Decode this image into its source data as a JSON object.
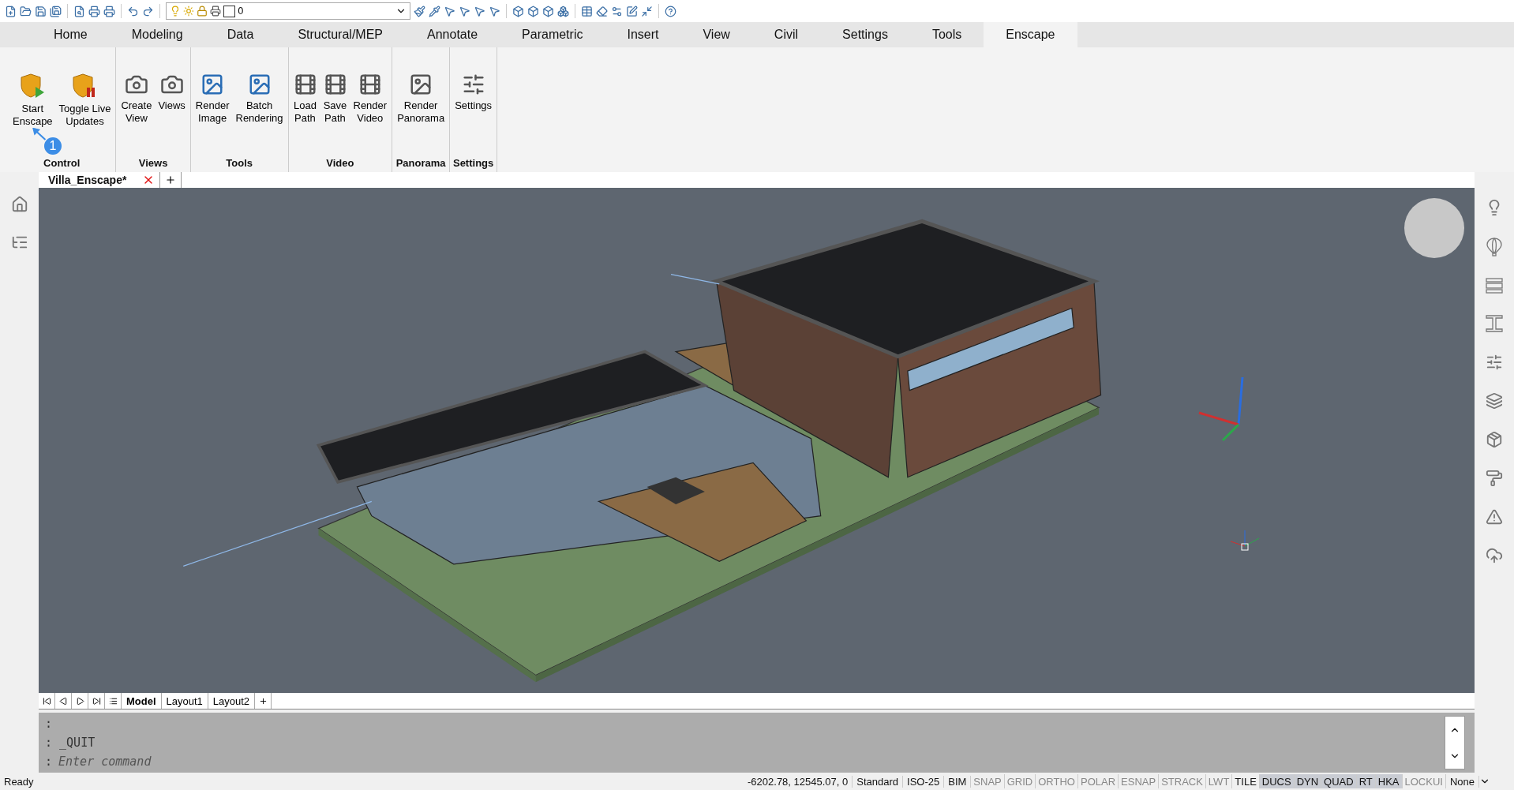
{
  "quick_toolbar": {
    "layer": "0"
  },
  "ribbon_tabs": [
    {
      "label": "Home",
      "selected": false
    },
    {
      "label": "Modeling",
      "selected": false
    },
    {
      "label": "Data",
      "selected": false
    },
    {
      "label": "Structural/MEP",
      "selected": false
    },
    {
      "label": "Annotate",
      "selected": false
    },
    {
      "label": "Parametric",
      "selected": false
    },
    {
      "label": "Insert",
      "selected": false
    },
    {
      "label": "View",
      "selected": false
    },
    {
      "label": "Civil",
      "selected": false
    },
    {
      "label": "Settings",
      "selected": false
    },
    {
      "label": "Tools",
      "selected": false
    },
    {
      "label": "Enscape",
      "selected": true
    }
  ],
  "ribbon_panels": [
    {
      "title": "Control",
      "buttons": [
        {
          "label": "Start\nEnscape",
          "kind": "start"
        },
        {
          "label": "Toggle Live\nUpdates",
          "kind": "toggle"
        }
      ]
    },
    {
      "title": "Views",
      "buttons": [
        {
          "label": "Create\nView",
          "kind": "camera"
        },
        {
          "label": "Views",
          "kind": "camera"
        }
      ]
    },
    {
      "title": "Tools",
      "buttons": [
        {
          "label": "Render\nImage",
          "kind": "render"
        },
        {
          "label": "Batch\nRendering",
          "kind": "batch"
        }
      ]
    },
    {
      "title": "Video",
      "buttons": [
        {
          "label": "Load\nPath",
          "kind": "film"
        },
        {
          "label": "Save\nPath",
          "kind": "film"
        },
        {
          "label": "Render\nVideo",
          "kind": "film"
        }
      ]
    },
    {
      "title": "Panorama",
      "buttons": [
        {
          "label": "Render\nPanorama",
          "kind": "panorama"
        }
      ]
    },
    {
      "title": "Settings",
      "buttons": [
        {
          "label": "Settings",
          "kind": "settings"
        }
      ]
    }
  ],
  "callout": {
    "label": "1"
  },
  "document_tabs": [
    {
      "label": "Villa_Enscape*",
      "selected": true
    }
  ],
  "layout_tabs": [
    {
      "label": "Model",
      "selected": true
    },
    {
      "label": "Layout1",
      "selected": false
    },
    {
      "label": "Layout2",
      "selected": false
    }
  ],
  "command_line": {
    "history": [
      ":",
      ": _QUIT"
    ],
    "prompt": ":",
    "placeholder": "Enter command"
  },
  "status_bar": {
    "state": "Ready",
    "coordinates": "-6202.78, 12545.07, 0",
    "styles": [
      "Standard",
      "ISO-25",
      "BIM"
    ],
    "toggles": [
      {
        "label": "SNAP",
        "on": false,
        "highlighted": false
      },
      {
        "label": "GRID",
        "on": false,
        "highlighted": false
      },
      {
        "label": "ORTHO",
        "on": false,
        "highlighted": false
      },
      {
        "label": "POLAR",
        "on": false,
        "highlighted": false
      },
      {
        "label": "ESNAP",
        "on": false,
        "highlighted": false
      },
      {
        "label": "STRACK",
        "on": false,
        "highlighted": false
      },
      {
        "label": "LWT",
        "on": false,
        "highlighted": false
      },
      {
        "label": "TILE",
        "on": true,
        "highlighted": false
      },
      {
        "label": "DUCS",
        "on": true,
        "highlighted": true
      },
      {
        "label": "DYN",
        "on": true,
        "highlighted": true
      },
      {
        "label": "QUAD",
        "on": true,
        "highlighted": true
      },
      {
        "label": "RT",
        "on": true,
        "highlighted": true
      },
      {
        "label": "HKA",
        "on": true,
        "highlighted": true
      },
      {
        "label": "LOCKUI",
        "on": false,
        "highlighted": false
      }
    ],
    "selection": "None"
  }
}
